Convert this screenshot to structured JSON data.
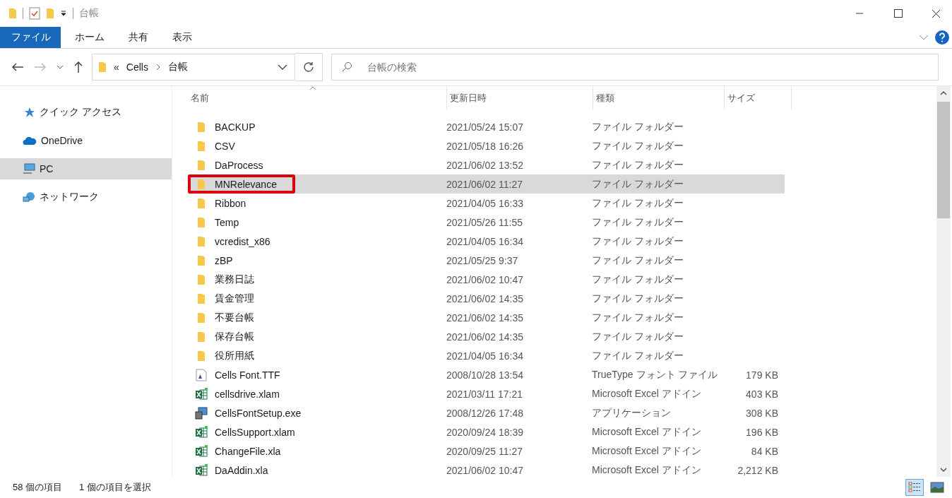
{
  "window": {
    "title": "台帳"
  },
  "ribbon_tabs": [
    {
      "label": "ファイル",
      "selected": true
    },
    {
      "label": "ホーム",
      "selected": false
    },
    {
      "label": "共有",
      "selected": false
    },
    {
      "label": "表示",
      "selected": false
    }
  ],
  "address": {
    "overflow": "«",
    "path": [
      "Cells",
      "台帳"
    ]
  },
  "search": {
    "placeholder": "台帳の検索"
  },
  "sidebar": {
    "items": [
      {
        "label": "クイック アクセス",
        "kind": "star",
        "selected": false
      },
      {
        "label": "OneDrive",
        "kind": "cloud",
        "selected": false
      },
      {
        "label": "PC",
        "kind": "pc",
        "selected": true
      },
      {
        "label": "ネットワーク",
        "kind": "network",
        "selected": false
      }
    ]
  },
  "table": {
    "columns": [
      "名前",
      "更新日時",
      "種類",
      "サイズ"
    ],
    "rows": [
      {
        "kind": "folder",
        "name": "BACKUP",
        "date": "2021/05/24 15:07",
        "type": "ファイル フォルダー",
        "selected": false,
        "marked": false
      },
      {
        "kind": "folder",
        "name": "CSV",
        "date": "2021/05/18 16:26",
        "type": "ファイル フォルダー",
        "selected": false,
        "marked": false
      },
      {
        "kind": "folder",
        "name": "DaProcess",
        "date": "2021/06/02 13:52",
        "type": "ファイル フォルダー",
        "selected": false,
        "marked": false
      },
      {
        "kind": "folder",
        "name": "MNRelevance",
        "date": "2021/06/02 11:27",
        "type": "ファイル フォルダー",
        "selected": true,
        "marked": true
      },
      {
        "kind": "folder",
        "name": "Ribbon",
        "date": "2021/04/05 16:33",
        "type": "ファイル フォルダー",
        "selected": false,
        "marked": false
      },
      {
        "kind": "folder",
        "name": "Temp",
        "date": "2021/05/26 11:55",
        "type": "ファイル フォルダー",
        "selected": false,
        "marked": false
      },
      {
        "kind": "folder",
        "name": "vcredist_x86",
        "date": "2021/04/05 16:34",
        "type": "ファイル フォルダー",
        "selected": false,
        "marked": false
      },
      {
        "kind": "folder",
        "name": "zBP",
        "date": "2021/05/25 9:37",
        "type": "ファイル フォルダー",
        "selected": false,
        "marked": false
      },
      {
        "kind": "folder",
        "name": "業務日誌",
        "date": "2021/06/02 10:47",
        "type": "ファイル フォルダー",
        "selected": false,
        "marked": false
      },
      {
        "kind": "folder",
        "name": "賃金管理",
        "date": "2021/06/02 14:35",
        "type": "ファイル フォルダー",
        "selected": false,
        "marked": false
      },
      {
        "kind": "folder",
        "name": "不要台帳",
        "date": "2021/06/02 14:35",
        "type": "ファイル フォルダー",
        "selected": false,
        "marked": false
      },
      {
        "kind": "folder",
        "name": "保存台帳",
        "date": "2021/06/02 14:35",
        "type": "ファイル フォルダー",
        "selected": false,
        "marked": false
      },
      {
        "kind": "folder",
        "name": "役所用紙",
        "date": "2021/04/05 16:34",
        "type": "ファイル フォルダー",
        "selected": false,
        "marked": false
      },
      {
        "kind": "font",
        "name": "Cells Font.TTF",
        "date": "2008/10/28 13:54",
        "type": "TrueType フォント ファイル",
        "size": "179 KB",
        "selected": false,
        "marked": false
      },
      {
        "kind": "excel",
        "name": "cellsdrive.xlam",
        "date": "2021/03/11 17:21",
        "type": "Microsoft Excel アドイン",
        "size": "403 KB",
        "selected": false,
        "marked": false
      },
      {
        "kind": "exe",
        "name": "CellsFontSetup.exe",
        "date": "2008/12/26 17:48",
        "type": "アプリケーション",
        "size": "308 KB",
        "selected": false,
        "marked": false
      },
      {
        "kind": "excel",
        "name": "CellsSupport.xlam",
        "date": "2020/09/24 18:39",
        "type": "Microsoft Excel アドイン",
        "size": "196 KB",
        "selected": false,
        "marked": false
      },
      {
        "kind": "excel",
        "name": "ChangeFile.xla",
        "date": "2020/09/25 11:27",
        "type": "Microsoft Excel アドイン",
        "size": "84 KB",
        "selected": false,
        "marked": false
      },
      {
        "kind": "excel",
        "name": "DaAddin.xla",
        "date": "2021/06/02 10:47",
        "type": "Microsoft Excel アドイン",
        "size": "2,212 KB",
        "selected": false,
        "marked": false
      }
    ]
  },
  "status_bar": {
    "count": "58 個の項目",
    "selection": "1 個の項目を選択"
  },
  "view_buttons": [
    {
      "kind": "details",
      "selected": true
    },
    {
      "kind": "thumbnails",
      "selected": false
    }
  ]
}
